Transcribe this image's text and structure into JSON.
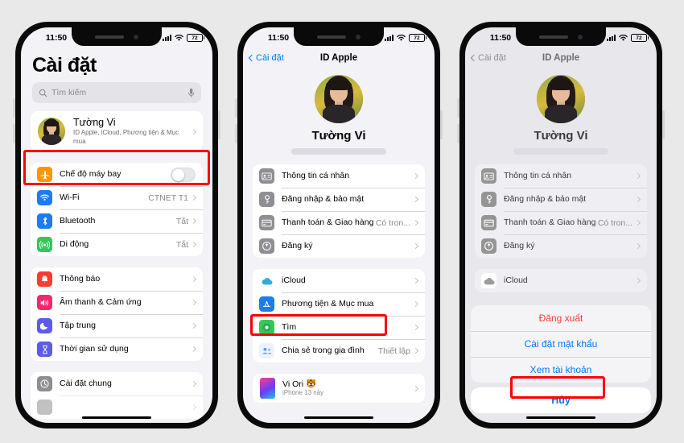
{
  "status_bar": {
    "time": "11:50",
    "battery": "72",
    "wifi_icon": "wifi-icon",
    "signal_icon": "cellular-icon"
  },
  "phone1": {
    "title": "Cài đặt",
    "search": {
      "placeholder": "Tìm kiếm",
      "icon": "search-icon",
      "mic_icon": "microphone-icon"
    },
    "profile": {
      "name": "Tường Vi",
      "subtitle": "ID Apple, iCloud, Phương tiện & Mục mua",
      "avatar": "user-avatar"
    },
    "group1": [
      {
        "label": "Chế độ máy bay",
        "icon": "airplane-icon",
        "color": "#ff9500",
        "control": "toggle",
        "value": ""
      },
      {
        "label": "Wi-Fi",
        "icon": "wifi-icon",
        "color": "#1c7cf0",
        "control": "chevron",
        "value": "CTNET T1"
      },
      {
        "label": "Bluetooth",
        "icon": "bluetooth-icon",
        "color": "#1c7cf0",
        "control": "chevron",
        "value": "Tắt"
      },
      {
        "label": "Di động",
        "icon": "cellular-antenna-icon",
        "color": "#34c759",
        "control": "chevron",
        "value": "Tắt"
      }
    ],
    "group2": [
      {
        "label": "Thông báo",
        "icon": "bell-icon",
        "color": "#ff3b30",
        "control": "chevron",
        "value": ""
      },
      {
        "label": "Âm thanh & Cảm ứng",
        "icon": "speaker-icon",
        "color": "#f8276b",
        "control": "chevron",
        "value": ""
      },
      {
        "label": "Tập trung",
        "icon": "moon-icon",
        "color": "#5e5ce6",
        "control": "chevron",
        "value": ""
      },
      {
        "label": "Thời gian sử dụng",
        "icon": "hourglass-icon",
        "color": "#5e5ce6",
        "control": "chevron",
        "value": ""
      }
    ],
    "group3": [
      {
        "label": "Cài đặt chung",
        "icon": "gear-icon",
        "color": "#8e8e93",
        "control": "chevron",
        "value": ""
      }
    ]
  },
  "phone2": {
    "nav": {
      "back": "Cài đặt",
      "title": "ID Apple"
    },
    "account": {
      "name": "Tường Vi",
      "email_redacted": true,
      "avatar": "user-avatar"
    },
    "group1": [
      {
        "label": "Thông tin cá nhân",
        "icon": "contact-card-icon",
        "value": ""
      },
      {
        "label": "Đăng nhập & bảo mật",
        "icon": "key-icon",
        "value": ""
      },
      {
        "label": "Thanh toán & Giao hàng",
        "icon": "credit-card-icon",
        "value": "Có tron..."
      },
      {
        "label": "Đăng ký",
        "icon": "subscription-icon",
        "value": ""
      }
    ],
    "group2": [
      {
        "label": "iCloud",
        "icon": "icloud-icon",
        "color": "#34aadc",
        "value": ""
      },
      {
        "label": "Phương tiện & Mục mua",
        "icon": "app-store-icon",
        "color": "#1c7cf0",
        "value": ""
      },
      {
        "label": "Tìm",
        "icon": "find-my-icon",
        "color": "#34c759",
        "value": ""
      },
      {
        "label": "Chia sẻ trong gia đình",
        "icon": "family-sharing-icon",
        "color": "#5e9cf5",
        "value": "Thiết lập"
      }
    ],
    "device": {
      "name": "Vi Ori 🐯",
      "subtitle": "iPhone 13 này",
      "icon": "iphone-icon"
    },
    "highlight": "Phương tiện & Mục mua"
  },
  "phone3": {
    "nav": {
      "back": "Cài đặt",
      "title": "ID Apple"
    },
    "account": {
      "name": "Tường Vi",
      "email_redacted": true,
      "avatar": "user-avatar"
    },
    "group1": [
      {
        "label": "Thông tin cá nhân",
        "icon": "contact-card-icon",
        "value": ""
      },
      {
        "label": "Đăng nhập & bảo mật",
        "icon": "key-icon",
        "value": ""
      },
      {
        "label": "Thanh toán & Giao hàng",
        "icon": "credit-card-icon",
        "value": "Có tron..."
      },
      {
        "label": "Đăng ký",
        "icon": "subscription-icon",
        "value": ""
      }
    ],
    "group2": [
      {
        "label": "iCloud",
        "icon": "icloud-icon",
        "color": "#34aadc",
        "value": ""
      }
    ],
    "device": {
      "name": "",
      "subtitle": "iPhone 13 này",
      "icon": "iphone-icon"
    },
    "action_sheet": {
      "items": [
        {
          "label": "Đăng xuất",
          "style": "destructive"
        },
        {
          "label": "Cài đặt mật khẩu",
          "style": "default"
        },
        {
          "label": "Xem tài khoản",
          "style": "default"
        }
      ],
      "cancel": "Hủy",
      "highlight": "Xem tài khoản"
    }
  },
  "colors": {
    "accent": "#007aff",
    "destructive": "#ff3b30",
    "annotation": "#ff0000",
    "page_bg": "#e9e9e9"
  }
}
